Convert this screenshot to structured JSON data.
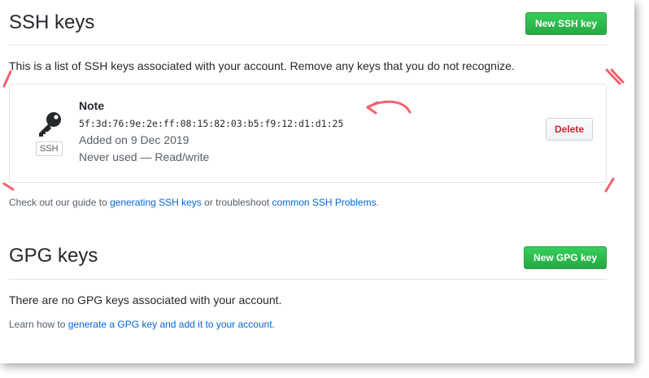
{
  "ssh": {
    "title": "SSH keys",
    "new_button": "New SSH key",
    "description": "This is a list of SSH keys associated with your account. Remove any keys that you do not recognize.",
    "key": {
      "title": "Note",
      "fingerprint": "5f:3d:76:9e:2e:ff:08:15:82:03:b5:f9:12:d1:d1:25",
      "added": "Added on 9 Dec 2019",
      "usage": "Never used — Read/write",
      "badge": "SSH",
      "delete_label": "Delete"
    },
    "guide": {
      "prefix": "Check out our guide to ",
      "link1": "generating SSH keys",
      "middle": " or troubleshoot ",
      "link2": "common SSH Problems",
      "suffix": "."
    }
  },
  "gpg": {
    "title": "GPG keys",
    "new_button": "New GPG key",
    "empty_text": "There are no GPG keys associated with your account.",
    "learn": {
      "prefix": "Learn how to ",
      "link": "generate a GPG key and add it to your account",
      "suffix": "."
    }
  },
  "colors": {
    "primary_green": "#28a745",
    "danger_red": "#cb2431",
    "link_blue": "#0366d6",
    "annotation_red": "#f0626f"
  },
  "icons": {
    "key": "key-icon"
  }
}
